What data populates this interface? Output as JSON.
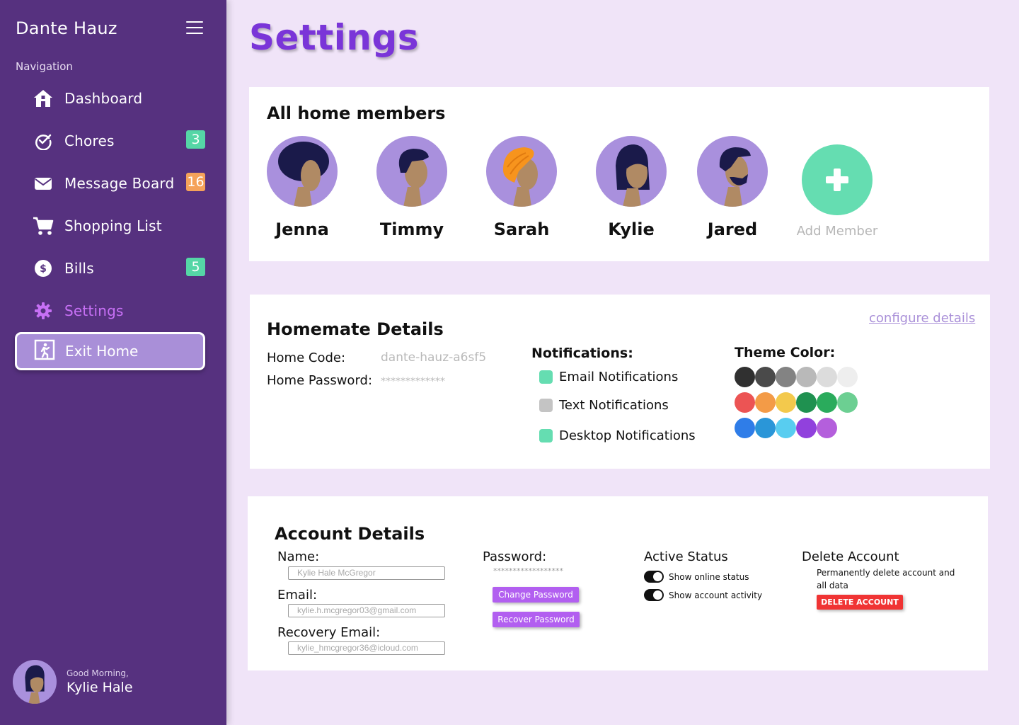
{
  "app": {
    "brand": "Dante Hauz"
  },
  "sidebar": {
    "heading": "Navigation",
    "items": [
      {
        "label": "Dashboard",
        "icon": "home-icon"
      },
      {
        "label": "Chores",
        "icon": "check-circle-icon",
        "badge": "3",
        "badge_color": "#55d6a6"
      },
      {
        "label": "Message Board",
        "icon": "envelope-icon",
        "badge": "16",
        "badge_color": "#f5a25a"
      },
      {
        "label": "Shopping List",
        "icon": "cart-icon"
      },
      {
        "label": "Bills",
        "icon": "dollar-icon",
        "badge": "5",
        "badge_color": "#55d6a6"
      },
      {
        "label": "Settings",
        "icon": "gear-icon",
        "active": true
      }
    ],
    "exit_label": "Exit Home",
    "user": {
      "greeting": "Good Morning,",
      "name": "Kylie Hale"
    }
  },
  "page": {
    "title": "Settings"
  },
  "members": {
    "title": "All home members",
    "list": [
      {
        "name": "Jenna"
      },
      {
        "name": "Timmy"
      },
      {
        "name": "Sarah"
      },
      {
        "name": "Kylie"
      },
      {
        "name": "Jared"
      }
    ],
    "add_label": "Add Member"
  },
  "homemate": {
    "title": "Homemate Details",
    "configure_link": "configure details",
    "home_code_label": "Home Code:",
    "home_code_value": "dante-hauz-a6sf5",
    "home_password_label": "Home Password:",
    "home_password_value": "*************",
    "notifications_title": "Notifications:",
    "notifications": [
      {
        "label": "Email Notifications",
        "enabled": true
      },
      {
        "label": "Text Notifications",
        "enabled": false
      },
      {
        "label": "Desktop Notifications",
        "enabled": true
      }
    ],
    "theme_title": "Theme Color:",
    "theme_colors": [
      [
        "#303030",
        "#4a4a4a",
        "#838383",
        "#b9b9b9",
        "#dcdcdc",
        "#eeeeee"
      ],
      [
        "#ec5454",
        "#f39b47",
        "#f3c94c",
        "#1f9150",
        "#2aab5c",
        "#6ccf92"
      ],
      [
        "#2f7de8",
        "#2a96d8",
        "#58cdf0",
        "#9141dd",
        "#b45fdc"
      ]
    ]
  },
  "account": {
    "title": "Account Details",
    "name_label": "Name:",
    "name_value": "Kylie Hale McGregor",
    "email_label": "Email:",
    "email_value": "kylie.h.mcgregor03@gmail.com",
    "recovery_label": "Recovery Email:",
    "recovery_value": "kylie_hmcgregor36@icloud.com",
    "password_label": "Password:",
    "password_value": "******************",
    "change_password": "Change Password",
    "recover_password": "Recover Password",
    "active_status_title": "Active Status",
    "toggles": [
      {
        "label": "Show online status",
        "on": true
      },
      {
        "label": "Show account activity",
        "on": true
      }
    ],
    "delete_title": "Delete Account",
    "delete_desc": "Permanently delete account and all data",
    "delete_button": "DELETE ACCOUNT"
  }
}
